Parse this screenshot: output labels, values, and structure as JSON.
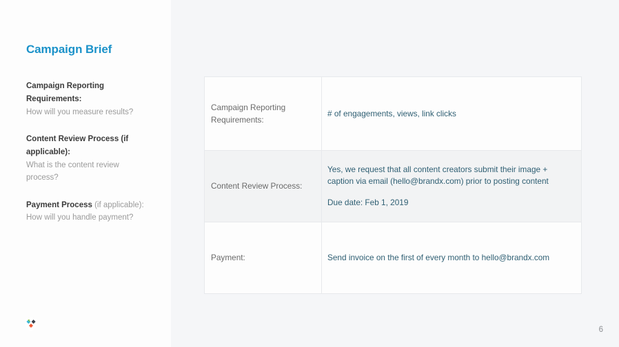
{
  "slide": {
    "page_number": "6",
    "accent_color": "#1b92c9",
    "value_text_color": "#2f5f73",
    "shaded_row_color": "#f2f3f4",
    "background_color": "#f5f6f8",
    "logo_name": "brand-logo"
  },
  "sidebar": {
    "title": "Campaign Brief",
    "questions": [
      {
        "heading": "Campaign Reporting Requirements:",
        "heading_soft": "",
        "subtext": "How will you measure results?"
      },
      {
        "heading": "Content Review Process (if applicable):",
        "heading_soft": "",
        "subtext": "What is the content review process?"
      },
      {
        "heading": "Payment Process ",
        "heading_soft": "(if applicable):",
        "subtext": "How will you handle payment?"
      }
    ]
  },
  "table": {
    "rows": [
      {
        "label": "Campaign Reporting Requirements:",
        "value_paragraphs": [
          "# of engagements, views, link clicks"
        ],
        "shaded": false
      },
      {
        "label": "Content Review Process:",
        "value_paragraphs": [
          "Yes, we request that all content creators submit their image + caption via email (hello@brandx.com) prior to posting content",
          "Due date: Feb 1, 2019"
        ],
        "shaded": true
      },
      {
        "label": "Payment:",
        "value_paragraphs": [
          "Send invoice on the first of every month to hello@brandx.com"
        ],
        "shaded": false
      }
    ]
  }
}
